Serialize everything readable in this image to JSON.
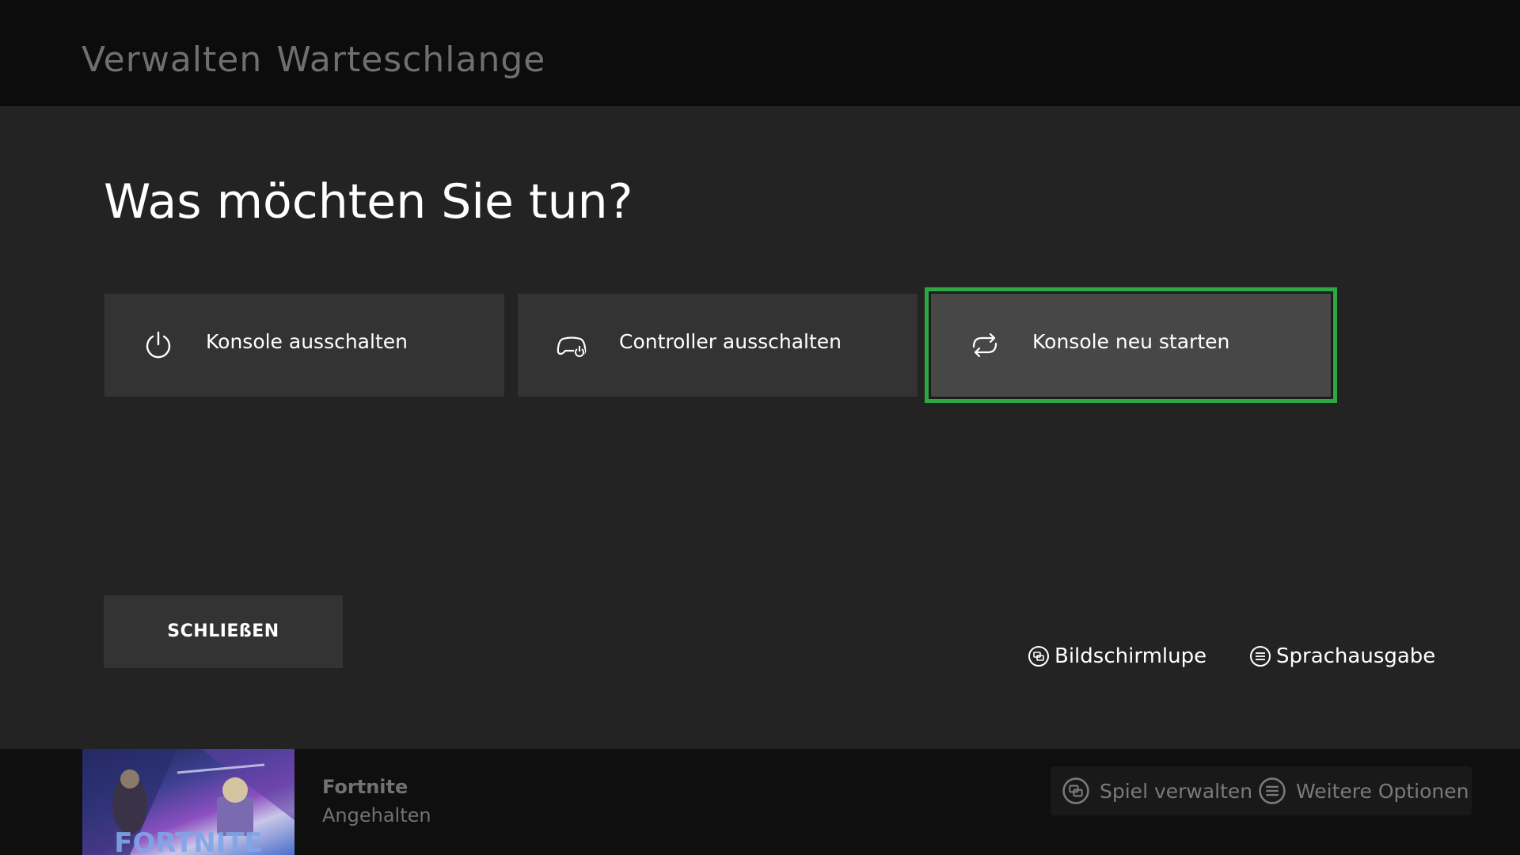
{
  "topbar": {
    "tabs": [
      "Verwalten",
      "Warteschlange"
    ]
  },
  "dialog": {
    "question": "Was möchten Sie tun?",
    "options": [
      {
        "label": "Konsole ausschalten",
        "icon": "power-icon"
      },
      {
        "label": "Controller ausschalten",
        "icon": "controller-power-icon"
      },
      {
        "label": "Konsole neu starten",
        "icon": "restart-icon",
        "focused": true
      }
    ],
    "close_label": "SCHLIEßEN",
    "hints": [
      {
        "label": "Bildschirmlupe",
        "icon": "view-button-icon"
      },
      {
        "label": "Sprachausgabe",
        "icon": "menu-button-icon"
      }
    ]
  },
  "bottombar": {
    "game": {
      "name": "Fortnite",
      "status": "Angehalten",
      "thumbnail_text": "FORTNITE"
    },
    "actions": [
      {
        "label": "Spiel verwalten",
        "icon": "view-button-icon"
      },
      {
        "label": "Weitere Optionen",
        "icon": "menu-button-icon"
      }
    ]
  },
  "colors": {
    "focus_border": "#2ea843",
    "dialog_bg": "#232323",
    "tile_bg": "#333333",
    "focused_tile_bg": "#474747"
  }
}
